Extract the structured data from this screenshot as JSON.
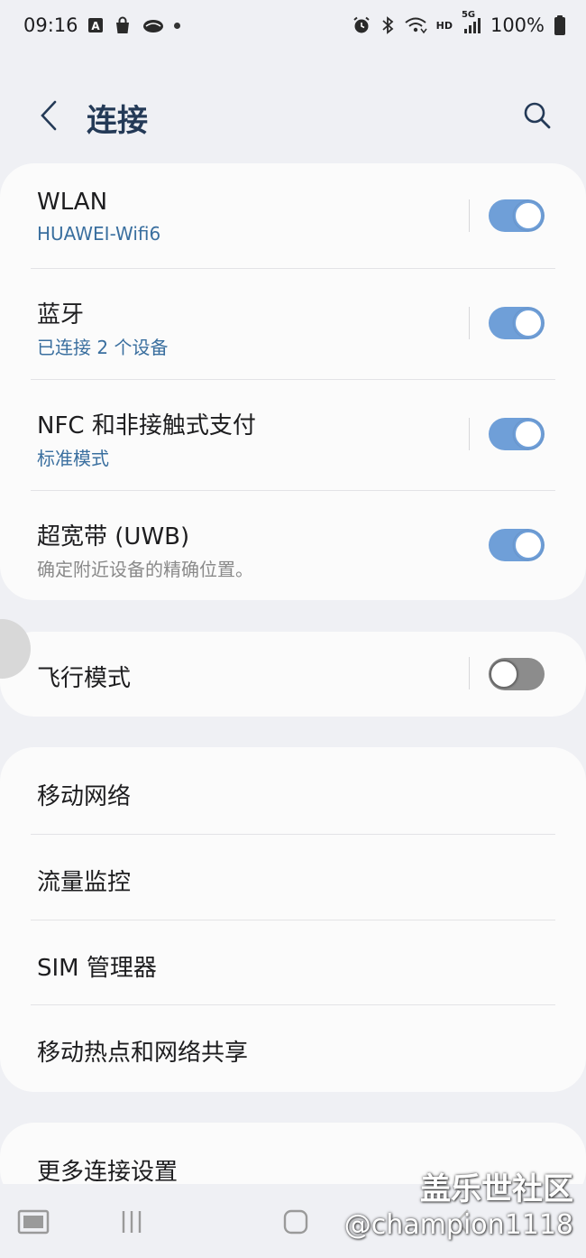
{
  "status_bar": {
    "time": "09:16",
    "battery_percent": "100%",
    "network_label": "5G",
    "hd_label": "HD",
    "left_icons": [
      "font-icon",
      "shopping-bag-icon",
      "cloud-icon",
      "dot-icon"
    ],
    "right_icons": [
      "alarm-icon",
      "bluetooth-icon",
      "wifi-icon",
      "signal-icon",
      "battery-icon"
    ]
  },
  "header": {
    "title": "连接",
    "back_icon": "chevron-left-icon",
    "search_icon": "search-icon"
  },
  "wireless_group": [
    {
      "title": "WLAN",
      "subtitle": "HUAWEI-Wifi6",
      "subtitle_style": "blue",
      "toggle": true
    },
    {
      "title": "蓝牙",
      "subtitle": "已连接 2 个设备",
      "subtitle_style": "blue",
      "toggle": true
    },
    {
      "title": "NFC 和非接触式支付",
      "subtitle": "标准模式",
      "subtitle_style": "blue",
      "toggle": true
    },
    {
      "title": "超宽带 (UWB)",
      "subtitle": "确定附近设备的精确位置。",
      "subtitle_style": "gray",
      "toggle": true
    }
  ],
  "airplane": {
    "title": "飞行模式",
    "toggle": false
  },
  "network_group": [
    {
      "title": "移动网络"
    },
    {
      "title": "流量监控"
    },
    {
      "title": "SIM 管理器"
    },
    {
      "title": "移动热点和网络共享"
    }
  ],
  "more": {
    "title": "更多连接设置"
  },
  "nav_bar": {
    "icons": [
      "keyboard-icon",
      "recents-icon",
      "home-icon",
      "back-icon"
    ]
  },
  "watermark": {
    "line1": "盖乐世社区",
    "line2": "@champion1118"
  },
  "colors": {
    "background": "#eff0f4",
    "card": "#fbfbfb",
    "title": "#243a57",
    "accent_blue": "#6f9fd8",
    "subtitle_blue": "#3a6f9f"
  }
}
